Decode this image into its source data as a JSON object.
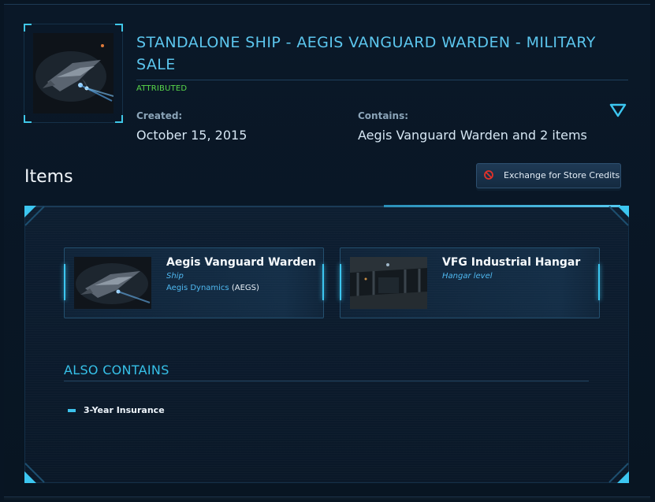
{
  "header": {
    "title": "STANDALONE SHIP - AEGIS VANGUARD WARDEN - MILITARY SALE",
    "status_badge": "ATTRIBUTED",
    "created_label": "Created:",
    "created_value": "October 15, 2015",
    "contains_label": "Contains:",
    "contains_value": "Aegis Vanguard Warden and 2 items",
    "toggle_icon": "chevron-down-triangle-icon"
  },
  "items_section": {
    "title": "Items",
    "exchange_button": {
      "label": "Exchange for Store Credits",
      "icon": "no-entry-icon"
    }
  },
  "cards": [
    {
      "name": "Aegis Vanguard Warden",
      "type": "Ship",
      "manufacturer": "Aegis Dynamics",
      "manufacturer_code": "(AEGS)"
    },
    {
      "name": "VFG Industrial Hangar",
      "type": "Hangar level"
    }
  ],
  "also_contains": {
    "title": "ALSO CONTAINS",
    "items": [
      "3-Year Insurance"
    ]
  },
  "colors": {
    "accent": "#5cc6ee",
    "status_green": "#59d84a",
    "background": "#081523"
  }
}
